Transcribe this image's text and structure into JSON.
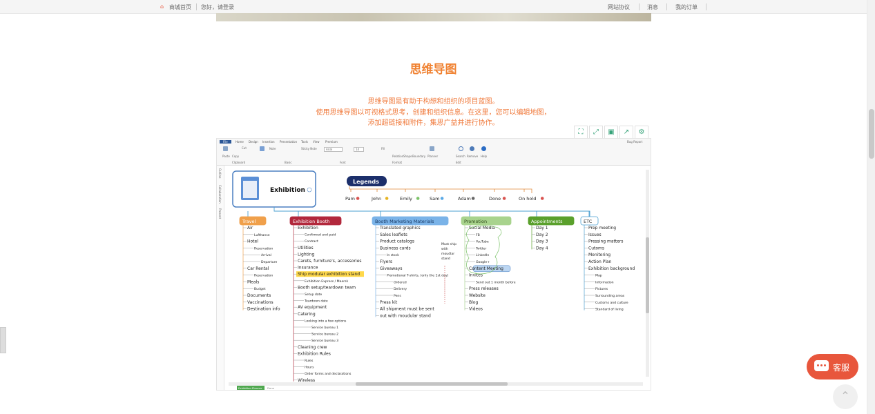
{
  "topbar": {
    "home": "商城首页",
    "greeting": "您好，请登录",
    "protocol": "网站协议",
    "messages": "消息",
    "orders": "我的订单"
  },
  "page": {
    "title": "思维导图",
    "desc1": "思维导图是有助于构想和组织的项目蓝图。",
    "desc2": "使用思维导图以可视格式思考，创建和组织信息。在这里，您可以编辑地图，",
    "desc3": "添加超链接和附件，集思广益并进行协作。"
  },
  "tools": [
    "fullscreen-icon",
    "expand-icon",
    "save-icon",
    "share-icon",
    "settings-icon"
  ],
  "ribbon": {
    "tabs": [
      "File",
      "Home",
      "Design",
      "Insertion",
      "Presentation",
      "Tools",
      "View",
      "Premium"
    ],
    "items": {
      "paste": "Paste",
      "copy": "Copy",
      "cut": "Cut",
      "note": "Note",
      "sticky": "Sticky Note",
      "font": "Arial",
      "size": "14",
      "fill": "Fill",
      "relation": "Relation",
      "shape": "Shape",
      "boundary": "Boundary",
      "planner": "Planner",
      "search": "Search",
      "remove": "Remove",
      "help": "Help",
      "bug": "Bug Report"
    },
    "groups": {
      "clipboard": "Clipboard",
      "basic": "Basic",
      "font": "Font",
      "format": "Format",
      "edit": "Edit"
    }
  },
  "sidepanel": [
    "Outline",
    "Collaboration",
    "Present"
  ],
  "mindmap": {
    "central": "Exhibition",
    "legend": {
      "title": "Legends",
      "items": [
        {
          "t": "Pam",
          "c": "#d9534f"
        },
        {
          "t": "John",
          "c": "#e6b422"
        },
        {
          "t": "Emily",
          "c": "#7cc36a"
        },
        {
          "t": "Sam",
          "c": "#5aa9e6"
        },
        {
          "t": "Adam",
          "c": "#666666"
        },
        {
          "t": "Done",
          "c": "#d9534f"
        },
        {
          "t": "On hold",
          "c": "#d9534f"
        }
      ]
    },
    "branches": [
      {
        "label": "Travel",
        "bg": "#f0a04b",
        "fg": "#ffffff",
        "items": [
          "Air",
          "Lufthanse",
          "Hotel",
          "Reservation",
          "Arrival",
          "Departure",
          "Car Rental",
          "Reservation",
          "Meals",
          "Budget",
          "Documents",
          "Vaccinations",
          "Destination info"
        ]
      },
      {
        "label": "Exhibition Booth",
        "bg": "#b2283c",
        "fg": "#ffffff",
        "items": [
          "Exhibition",
          "Confirmed and paid",
          "Contract",
          "Utilities",
          "Lighting",
          "Carets, furniture's, accessories",
          "Insurance",
          "Ship modular exhibition stand",
          "Exhibition Express / Maersk",
          "Booth setup/teardown team",
          "Setup date",
          "Teardown date",
          "AV equipment",
          "Catering",
          "Looking into a few options",
          "Service bureau 1",
          "Service bureau 2",
          "Service bureau 3",
          "Cleaning crew",
          "Exhibition Rules",
          "Rules",
          "Hours",
          "Order forms and declarations",
          "Wireless"
        ]
      },
      {
        "label": "Booth Marketing Materials",
        "bg": "#7ab3e8",
        "fg": "#1a3a66",
        "items": [
          "Translated graphics",
          "Sales leaflets",
          "Product catalogs",
          "Business cards",
          "In stock",
          "Flyers",
          "Giveaways",
          "Promotional T-shirts, (only the 1st day)",
          "Ordered",
          "Delivery",
          "Pens",
          "Press kit",
          "All shipment must be sent",
          "out with moudular stand"
        ],
        "note": [
          "Must ship",
          "with",
          "moudlar",
          "stand"
        ]
      },
      {
        "label": "Promotion",
        "bg": "#a8d38d",
        "fg": "#2f4a1a",
        "items": [
          "Social Media",
          "FB",
          "YouTube",
          "Twitter",
          "LinkedIn",
          "Google+",
          "Content Meeting",
          "Invites",
          "Send out 1 month before",
          "Press releases",
          "Website",
          "Blog",
          "Videos"
        ]
      },
      {
        "label": "Appointments",
        "bg": "#5aa02c",
        "fg": "#ffffff",
        "items": [
          "Day 1",
          "Day 2",
          "Day 3",
          "Day 4"
        ]
      },
      {
        "label": "ETC",
        "bg": "#ffffff",
        "fg": "#333333",
        "items": [
          "Prep meeting",
          "Issues",
          "Pressing matters",
          "Cutoms",
          "Monitoring",
          "Action Plan",
          "Exhibition background",
          "Map",
          "Information",
          "Pictures",
          "Surrounding areas",
          "Customs and culture",
          "Standard of living"
        ]
      }
    ]
  },
  "sheet": {
    "tab": "Exhibition Planner",
    "extra": "Done"
  },
  "chat": {
    "label": "客服"
  },
  "colors": {
    "orange": "#f08232",
    "accent": "#e8563c"
  }
}
